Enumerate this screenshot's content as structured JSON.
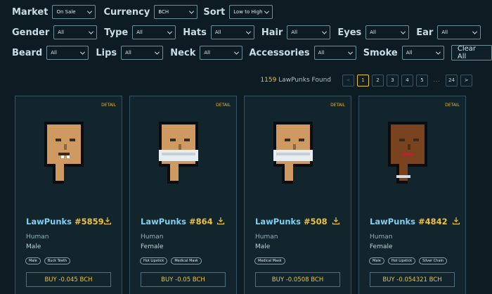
{
  "filters": {
    "row1": [
      {
        "label": "Market",
        "value": "On Sale"
      },
      {
        "label": "Currency",
        "value": "BCH"
      },
      {
        "label": "Sort",
        "value": "Low to High"
      }
    ],
    "row2": [
      {
        "label": "Gender",
        "value": "All"
      },
      {
        "label": "Type",
        "value": "All"
      },
      {
        "label": "Hats",
        "value": "All"
      },
      {
        "label": "Hair",
        "value": "All"
      },
      {
        "label": "Eyes",
        "value": "All"
      },
      {
        "label": "Ear",
        "value": "All"
      }
    ],
    "row3": [
      {
        "label": "Beard",
        "value": "All"
      },
      {
        "label": "Lips",
        "value": "All"
      },
      {
        "label": "Neck",
        "value": "All"
      },
      {
        "label": "Accessories",
        "value": "All"
      },
      {
        "label": "Smoke",
        "value": "All"
      }
    ],
    "clear_label": "Clear All"
  },
  "results": {
    "count": "1159",
    "suffix": "LawPunks Found"
  },
  "pagination": {
    "prev": "<",
    "pages": [
      "1",
      "2",
      "3",
      "4",
      "5"
    ],
    "ellipsis": "...",
    "last": "24",
    "next": ">",
    "current": "1"
  },
  "cards": [
    {
      "detail": "DETAIL",
      "name": "LawPunks ",
      "id": "#5859",
      "type": "Human",
      "gender": "Male",
      "tags": [
        "Male",
        "Buck Teeth"
      ],
      "buy_prefix": "BUY - ",
      "price": "0.045 BCH",
      "skin": "#cf9a62",
      "features": [
        "teeth"
      ]
    },
    {
      "detail": "DETAIL",
      "name": "LawPunks ",
      "id": "#864",
      "type": "Human",
      "gender": "Female",
      "tags": [
        "Hot Lipstick",
        "Medical Mask"
      ],
      "buy_prefix": "BUY - ",
      "price": "0.05 BCH",
      "skin": "#cf9a62",
      "features": [
        "mask"
      ]
    },
    {
      "detail": "DETAIL",
      "name": "LawPunks ",
      "id": "#508",
      "type": "Human",
      "gender": "Male",
      "tags": [
        "Medical Mask"
      ],
      "buy_prefix": "BUY - ",
      "price": "0.0508 BCH",
      "skin": "#cf9a62",
      "features": [
        "mask"
      ]
    },
    {
      "detail": "DETAIL",
      "name": "LawPunks ",
      "id": "#4842",
      "type": "Human",
      "gender": "Female",
      "tags": [
        "Male",
        "Hot Lipstick",
        "Silver Chain"
      ],
      "buy_prefix": "BUY - ",
      "price": "0.054321 BCH",
      "skin": "#7a4320",
      "features": [
        "chain",
        "lipstick"
      ]
    }
  ]
}
